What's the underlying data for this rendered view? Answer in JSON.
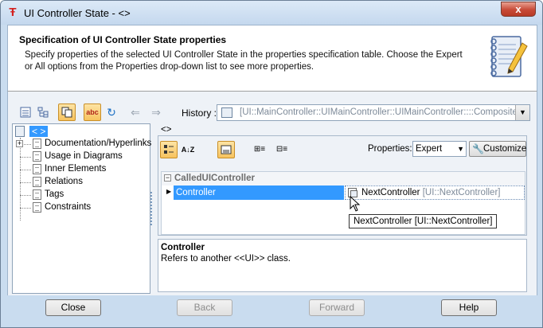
{
  "window": {
    "title": "UI Controller State - <>",
    "close_label": "x"
  },
  "header": {
    "title": "Specification of UI Controller State properties",
    "description": "Specify properties of the selected UI Controller State in the properties specification table. Choose the Expert or All options from the Properties drop-down list to see more properties."
  },
  "toolbar": {
    "history_label": "History :",
    "history_value": "[UI::MainController::UIMainController::UIMainController::::Composite::]"
  },
  "tree": {
    "root_label": "< >",
    "items": [
      {
        "label": "Documentation/Hyperlinks",
        "expandable": true
      },
      {
        "label": "Usage in Diagrams",
        "expandable": false
      },
      {
        "label": "Inner Elements",
        "expandable": false
      },
      {
        "label": "Relations",
        "expandable": false
      },
      {
        "label": "Tags",
        "expandable": false
      },
      {
        "label": "Constraints",
        "expandable": false
      }
    ]
  },
  "properties": {
    "element_label": "<>",
    "properties_label": "Properties:",
    "properties_value": "Expert",
    "customize_label": "Customize",
    "group_label": "CalledUIController",
    "row": {
      "name": "Controller",
      "value": "NextController",
      "value_qualifier": "[UI::NextController]"
    },
    "tooltip": "NextController [UI::NextController]"
  },
  "description": {
    "title": "Controller",
    "text": "Refers to another <<UI>> class."
  },
  "footer": {
    "close": "Close",
    "back": "Back",
    "forward": "Forward",
    "help": "Help"
  },
  "colors": {
    "selection": "#3399ff",
    "window_frame": "#c9dcef",
    "toggle_active": "#f7c35e"
  }
}
